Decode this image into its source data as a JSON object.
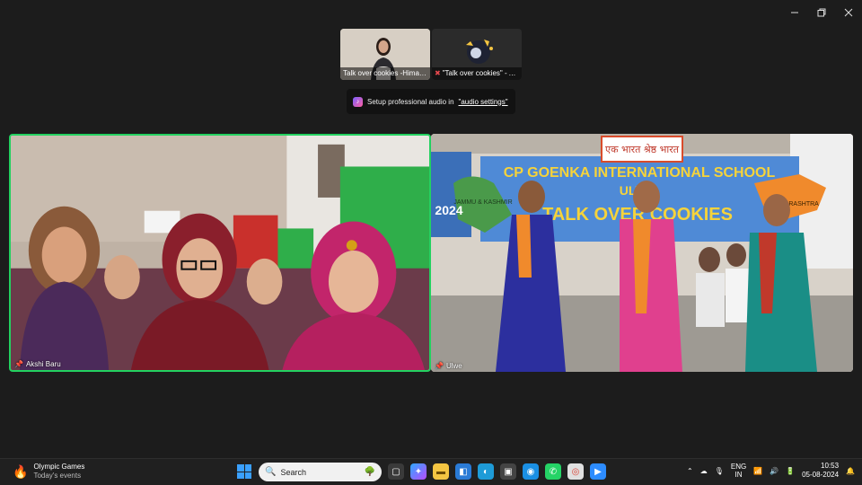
{
  "window": {
    "controls": [
      "minimize-icon",
      "restore-icon",
      "close-icon"
    ]
  },
  "thumbnails": [
    {
      "label": "Talk over cookies -Hima Ba..."
    },
    {
      "label": "\"Talk over cookies\" - A..."
    }
  ],
  "audio_banner": {
    "text": "Setup professional audio in",
    "link": "\"audio settings\""
  },
  "tiles": [
    {
      "name": "Akshi Baru"
    },
    {
      "name": "Ulwe"
    }
  ],
  "stage_banner": {
    "top_sign": "एक भारत श्रेष्ठ भारत",
    "line1": "CP GOENKA INTERNATIONAL SCHOOL",
    "line2": "ULWE",
    "line3": "TALK OVER COOKIES",
    "left_map_label": "JAMMU & KASHMIR",
    "right_map_label": "MAHARASHTRA",
    "year": "2024"
  },
  "taskbar": {
    "weather_title": "Olympic Games",
    "weather_sub": "Today's events",
    "search_placeholder": "Search",
    "lang_top": "ENG",
    "lang_bottom": "IN",
    "time": "10:53",
    "date": "05-08-2024"
  },
  "colors": {
    "active_speaker_border": "#23d160",
    "taskbar_bg": "#202020",
    "window_bg": "#1c1c1c"
  }
}
